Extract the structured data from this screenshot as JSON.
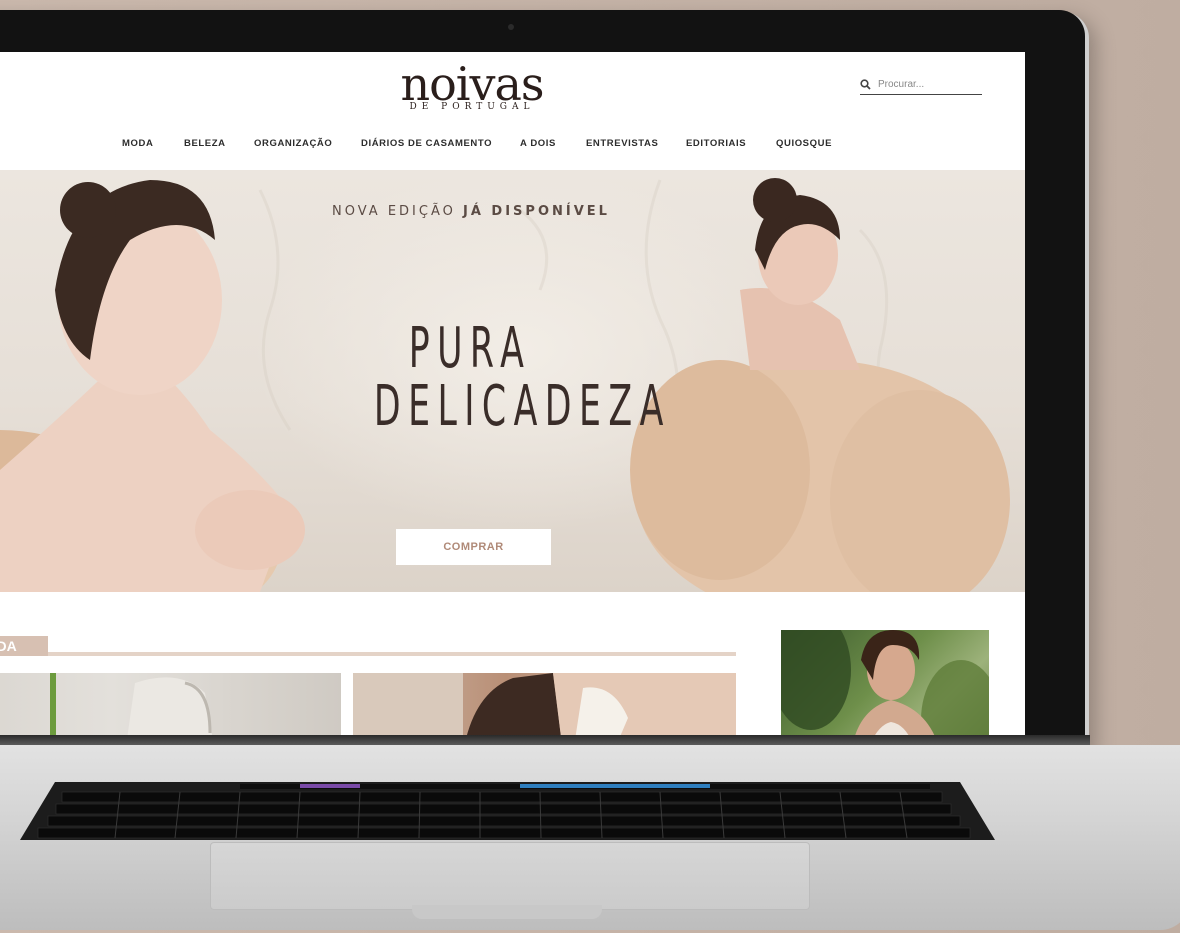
{
  "site": {
    "logo_main": "noivas",
    "logo_sub": "DE PORTUGAL"
  },
  "search": {
    "placeholder": "Procurar..."
  },
  "nav": {
    "items": [
      "MODA",
      "BELEZA",
      "ORGANIZAÇÃO",
      "DIÁRIOS DE CASAMENTO",
      "A DOIS",
      "ENTREVISTAS",
      "EDITORIAIS",
      "QUIOSQUE"
    ]
  },
  "hero": {
    "kicker_prefix": "NOVA EDIÇÃO",
    "kicker_bold": "JÁ DISPONÍVEL",
    "title_line1": "PURA",
    "title_line2": "DELICADEZA",
    "cta_label": "COMPRAR"
  },
  "sections": {
    "moda_label": "MODA"
  },
  "colors": {
    "accent": "#d7c0b2",
    "accent_line": "#e4d3c7",
    "cta_text": "#b08a78",
    "text_dark": "#2d2d2d"
  },
  "icons": {
    "search": "search-icon"
  }
}
